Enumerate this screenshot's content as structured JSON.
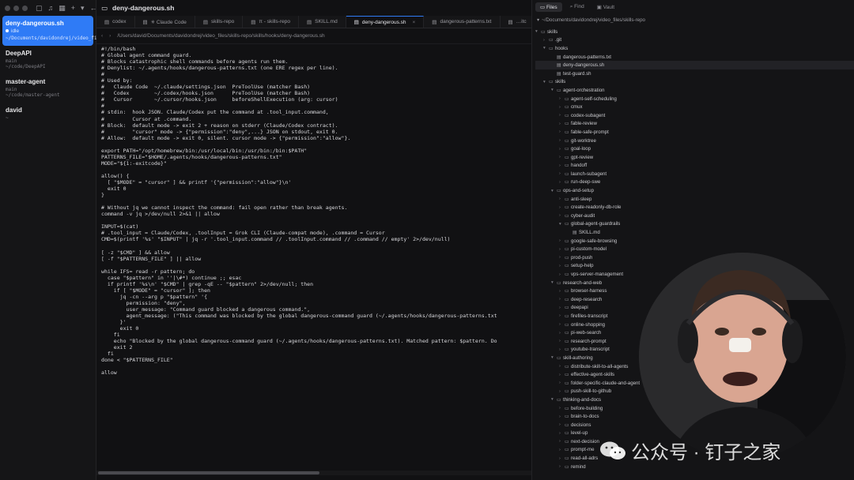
{
  "sidebar": {
    "sessions": [
      {
        "title": "deny-dangerous.sh",
        "status": "idle",
        "subtitle": "~/Documents/davidondrej/video_fi…",
        "active": true
      },
      {
        "title": "DeepAPI",
        "status": "",
        "subtitle": "main\n~/code/DeepAPI",
        "active": false
      },
      {
        "title": "master-agent",
        "status": "",
        "subtitle": "main\n~/code/master-agent",
        "active": false
      },
      {
        "title": "david",
        "status": "",
        "subtitle": "~",
        "active": false
      }
    ]
  },
  "editor": {
    "title": "deny-dangerous.sh",
    "tabs": [
      {
        "label": "codex",
        "active": false
      },
      {
        "label": "✳ Claude Code",
        "active": false
      },
      {
        "label": "skills-repo",
        "active": false
      },
      {
        "label": "π - skills-repo",
        "active": false
      },
      {
        "label": "SKILL.md",
        "active": false
      },
      {
        "label": "deny-dangerous.sh",
        "active": true
      },
      {
        "label": "dangerous-patterns.txt",
        "active": false
      },
      {
        "label": "…itc",
        "active": false
      }
    ],
    "path": "/Users/david/Documents/davidondrej/video_files/skills-repo/skills/hooks/deny-dangerous.sh",
    "code": "#!/bin/bash\n# Global agent command guard.\n# Blocks catastrophic shell commands before agents run them.\n# Denylist: ~/.agents/hooks/dangerous-patterns.txt (one ERE regex per line).\n#\n# Used by:\n#   Claude Code  ~/.claude/settings.json  PreToolUse (matcher Bash)\n#   Codex        ~/.codex/hooks.json      PreToolUse (matcher Bash)\n#   Cursor       ~/.cursor/hooks.json     beforeShellExecution (arg: cursor)\n#\n# stdin:  hook JSON. Claude/Codex put the command at .tool_input.command,\n#         Cursor at .command.\n# Block:  default mode -> exit 2 + reason on stderr (Claude/Codex contract).\n#         \"cursor\" mode -> {\"permission\":\"deny\",...} JSON on stdout, exit 0.\n# Allow:  default mode -> exit 0, silent. cursor mode -> {\"permission\":\"allow\"}.\n\nexport PATH=\"/opt/homebrew/bin:/usr/local/bin:/usr/bin:/bin:$PATH\"\nPATTERNS_FILE=\"$HOME/.agents/hooks/dangerous-patterns.txt\"\nMODE=\"${1:-exitcode}\"\n\nallow() {\n  [ \"$MODE\" = \"cursor\" ] && printf '{\"permission\":\"allow\"}\\n'\n  exit 0\n}\n\n# Without jq we cannot inspect the command: fail open rather than break agents.\ncommand -v jq >/dev/null 2>&1 || allow\n\nINPUT=$(cat)\n# .tool_input = Claude/Codex, .toolInput = Grok CLI (Claude-compat mode), .command = Cursor\nCMD=$(printf '%s' \"$INPUT\" | jq -r '.tool_input.command // .toolInput.command // .command // empty' 2>/dev/null)\n\n[ -z \"$CMD\" ] && allow\n[ -f \"$PATTERNS_FILE\" ] || allow\n\nwhile IFS= read -r pattern; do\n  case \"$pattern\" in ''|\\#*) continue ;; esac\n  if printf '%s\\n' \"$CMD\" | grep -qE -- \"$pattern\" 2>/dev/null; then\n    if [ \"$MODE\" = \"cursor\" ]; then\n      jq -cn --arg p \"$pattern\" '{\n        permission: \"deny\",\n        user_message: \"Command guard blocked a dangerous command.\",\n        agent_message: (\"This command was blocked by the global dangerous-command guard (~/.agents/hooks/dangerous-patterns.txt\n      }'\n      exit 0\n    fi\n    echo \"Blocked by the global dangerous-command guard (~/.agents/hooks/dangerous-patterns.txt). Matched pattern: $pattern. Do\n    exit 2\n  fi\ndone < \"$PATTERNS_FILE\"\n\nallow"
  },
  "right_panel": {
    "tabs": [
      {
        "label": "Files",
        "icon": "folder-icon",
        "active": true
      },
      {
        "label": "Find",
        "icon": "search-icon",
        "active": false
      },
      {
        "label": "Vault",
        "icon": "vault-icon",
        "active": false
      }
    ],
    "path": "~/Documents/davidondrej/video_files/skills-repo",
    "tree": [
      {
        "label": "skills",
        "depth": 0,
        "type": "folder",
        "open": true
      },
      {
        "label": ".git",
        "depth": 1,
        "type": "folder",
        "open": false
      },
      {
        "label": "hooks",
        "depth": 1,
        "type": "folder",
        "open": true
      },
      {
        "label": "dangerous-patterns.txt",
        "depth": 2,
        "type": "file"
      },
      {
        "label": "deny-dangerous.sh",
        "depth": 2,
        "type": "file",
        "selected": true
      },
      {
        "label": "test-guard.sh",
        "depth": 2,
        "type": "file"
      },
      {
        "label": "skills",
        "depth": 1,
        "type": "folder",
        "open": true
      },
      {
        "label": "agent-orchestration",
        "depth": 2,
        "type": "folder",
        "open": true
      },
      {
        "label": "agent-self-scheduling",
        "depth": 3,
        "type": "folder",
        "open": false
      },
      {
        "label": "cmux",
        "depth": 3,
        "type": "folder",
        "open": false
      },
      {
        "label": "codex-subagent",
        "depth": 3,
        "type": "folder",
        "open": false
      },
      {
        "label": "fable-review",
        "depth": 3,
        "type": "folder",
        "open": false
      },
      {
        "label": "fable-safe-prompt",
        "depth": 3,
        "type": "folder",
        "open": false
      },
      {
        "label": "git-worktree",
        "depth": 3,
        "type": "folder",
        "open": false
      },
      {
        "label": "goal-loop",
        "depth": 3,
        "type": "folder",
        "open": false
      },
      {
        "label": "gpt-review",
        "depth": 3,
        "type": "folder",
        "open": false
      },
      {
        "label": "handoff",
        "depth": 3,
        "type": "folder",
        "open": false
      },
      {
        "label": "launch-subagent",
        "depth": 3,
        "type": "folder",
        "open": false
      },
      {
        "label": "run-deep-swe",
        "depth": 3,
        "type": "folder",
        "open": false
      },
      {
        "label": "ops-and-setup",
        "depth": 2,
        "type": "folder",
        "open": true
      },
      {
        "label": "anti-sleep",
        "depth": 3,
        "type": "folder",
        "open": false
      },
      {
        "label": "create-readonly-db-role",
        "depth": 3,
        "type": "folder",
        "open": false
      },
      {
        "label": "cyber-audit",
        "depth": 3,
        "type": "folder",
        "open": false
      },
      {
        "label": "global-agent-guardrails",
        "depth": 3,
        "type": "folder",
        "open": true
      },
      {
        "label": "SKILL.md",
        "depth": 4,
        "type": "file"
      },
      {
        "label": "google-safe-browsing",
        "depth": 3,
        "type": "folder",
        "open": false
      },
      {
        "label": "pi-custom-model",
        "depth": 3,
        "type": "folder",
        "open": false
      },
      {
        "label": "prod-push",
        "depth": 3,
        "type": "folder",
        "open": false
      },
      {
        "label": "setup-help",
        "depth": 3,
        "type": "folder",
        "open": false
      },
      {
        "label": "vps-server-management",
        "depth": 3,
        "type": "folder",
        "open": false
      },
      {
        "label": "research-and-web",
        "depth": 2,
        "type": "folder",
        "open": true
      },
      {
        "label": "browser-harness",
        "depth": 3,
        "type": "folder",
        "open": false
      },
      {
        "label": "deep-research",
        "depth": 3,
        "type": "folder",
        "open": false
      },
      {
        "label": "deepapi",
        "depth": 3,
        "type": "folder",
        "open": false
      },
      {
        "label": "firefiles-transcript",
        "depth": 3,
        "type": "folder",
        "open": false
      },
      {
        "label": "online-shopping",
        "depth": 3,
        "type": "folder",
        "open": false
      },
      {
        "label": "pi-web-search",
        "depth": 3,
        "type": "folder",
        "open": false
      },
      {
        "label": "research-prompt",
        "depth": 3,
        "type": "folder",
        "open": false
      },
      {
        "label": "youtube-transcript",
        "depth": 3,
        "type": "folder",
        "open": false
      },
      {
        "label": "skill-authoring",
        "depth": 2,
        "type": "folder",
        "open": true
      },
      {
        "label": "distribute-skill-to-all-agents",
        "depth": 3,
        "type": "folder",
        "open": false
      },
      {
        "label": "effective-agent-skills",
        "depth": 3,
        "type": "folder",
        "open": false
      },
      {
        "label": "folder-specific-claude-and-agent",
        "depth": 3,
        "type": "folder",
        "open": false
      },
      {
        "label": "push-skill-to-github",
        "depth": 3,
        "type": "folder",
        "open": false
      },
      {
        "label": "thinking-and-docs",
        "depth": 2,
        "type": "folder",
        "open": true
      },
      {
        "label": "before-building",
        "depth": 3,
        "type": "folder",
        "open": false
      },
      {
        "label": "brain-to-docs",
        "depth": 3,
        "type": "folder",
        "open": false
      },
      {
        "label": "decisions",
        "depth": 3,
        "type": "folder",
        "open": false
      },
      {
        "label": "level-up",
        "depth": 3,
        "type": "folder",
        "open": false
      },
      {
        "label": "next-decision",
        "depth": 3,
        "type": "folder",
        "open": false
      },
      {
        "label": "prompt-me",
        "depth": 3,
        "type": "folder",
        "open": false
      },
      {
        "label": "read-all-adrs",
        "depth": 3,
        "type": "folder",
        "open": false
      },
      {
        "label": "remind",
        "depth": 3,
        "type": "folder",
        "open": false
      }
    ]
  },
  "watermark": {
    "text": "公众号 · 钉子之家",
    "icon": "wechat-logo-icon"
  },
  "colors": {
    "accent": "#2f7bf6",
    "editor_bg": "#111113",
    "panel_bg": "#141416"
  }
}
